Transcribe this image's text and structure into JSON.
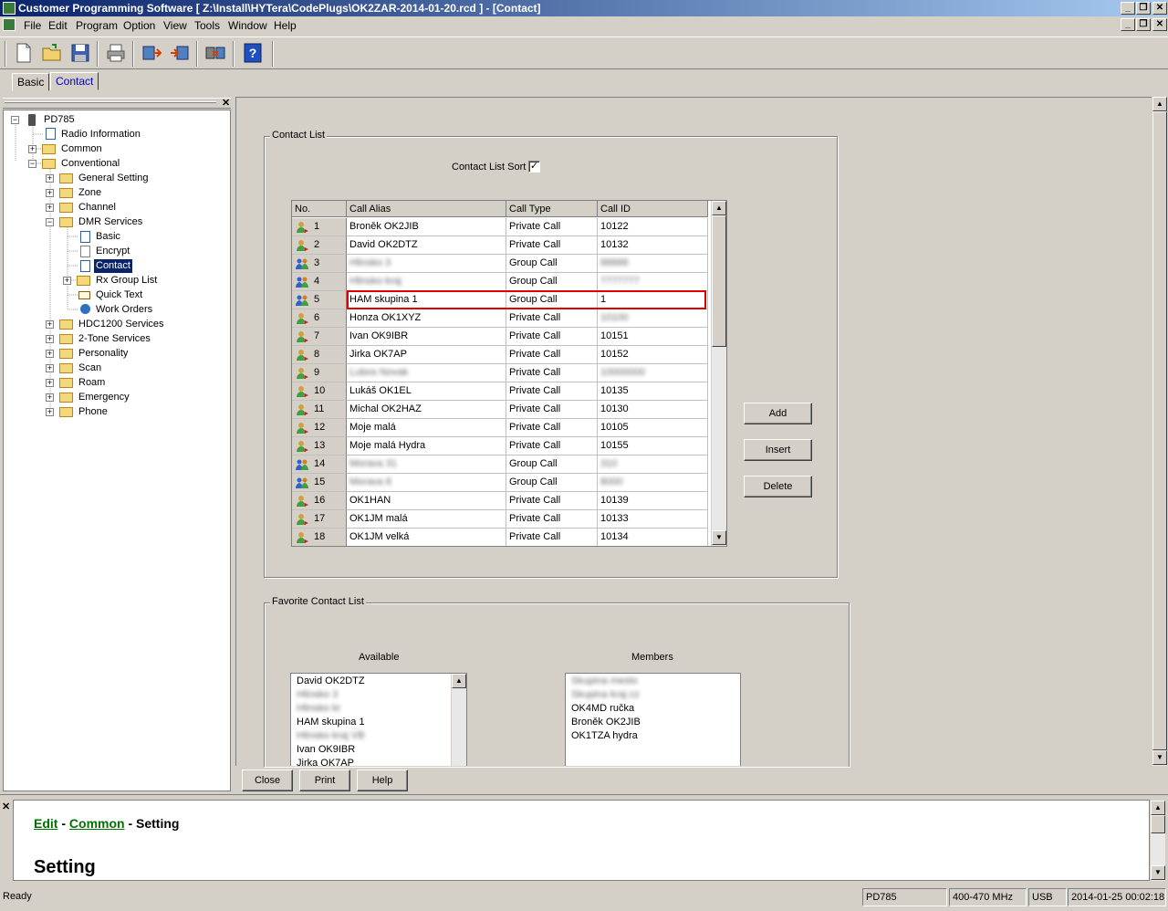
{
  "window": {
    "title": "Customer Programming Software [ Z:\\Install\\HYTera\\CodePlugs\\OK2ZAR-2014-01-20.rcd ] - [Contact]"
  },
  "menu": [
    "File",
    "Edit",
    "Program",
    "Option",
    "View",
    "Tools",
    "Window",
    "Help"
  ],
  "tabs": {
    "basic": "Basic",
    "contact": "Contact"
  },
  "tree": {
    "root": "PD785",
    "radio_information": "Radio Information",
    "common": "Common",
    "conventional": "Conventional",
    "general_setting": "General Setting",
    "zone": "Zone",
    "channel": "Channel",
    "dmr_services": "DMR Services",
    "basic": "Basic",
    "encrypt": "Encrypt",
    "contact": "Contact",
    "rx_group_list": "Rx Group List",
    "quick_text": "Quick Text",
    "work_orders": "Work Orders",
    "hdc1200": "HDC1200 Services",
    "two_tone": "2-Tone Services",
    "personality": "Personality",
    "scan": "Scan",
    "roam": "Roam",
    "emergency": "Emergency",
    "phone": "Phone"
  },
  "contact_list": {
    "group_title": "Contact List",
    "sort_label": "Contact List Sort",
    "sort_checked": true,
    "columns": [
      "No.",
      "Call Alias",
      "Call Type",
      "Call ID"
    ],
    "rows": [
      {
        "no": "1",
        "alias": "Broněk OK2JIB",
        "type": "Private Call",
        "id": "10122",
        "group": false
      },
      {
        "no": "2",
        "alias": "David OK2DTZ",
        "type": "Private Call",
        "id": "10132",
        "group": false
      },
      {
        "no": "3",
        "alias": "Hlinsko 3",
        "type": "Group Call",
        "id": "88888",
        "group": true,
        "blur_alias": true,
        "blur_id": true
      },
      {
        "no": "4",
        "alias": "Hlinsko kraj",
        "type": "Group Call",
        "id": "7777777",
        "group": true,
        "blur_alias": true,
        "blur_id": true
      },
      {
        "no": "5",
        "alias": "HAM skupina 1",
        "type": "Group Call",
        "id": "1",
        "group": true,
        "selected": true
      },
      {
        "no": "6",
        "alias": "Honza OK1XYZ",
        "type": "Private Call",
        "id": "10100",
        "group": false,
        "blur_alias_tail": true,
        "blur_id": true
      },
      {
        "no": "7",
        "alias": "Ivan OK9IBR",
        "type": "Private Call",
        "id": "10151",
        "group": false
      },
      {
        "no": "8",
        "alias": "Jirka OK7AP",
        "type": "Private Call",
        "id": "10152",
        "group": false
      },
      {
        "no": "9",
        "alias": "Lubos Novak",
        "type": "Private Call",
        "id": "10000000",
        "group": false,
        "blur_alias": true,
        "blur_id": true
      },
      {
        "no": "10",
        "alias": "Lukáš OK1EL",
        "type": "Private Call",
        "id": "10135",
        "group": false
      },
      {
        "no": "11",
        "alias": "Michal OK2HAZ",
        "type": "Private Call",
        "id": "10130",
        "group": false
      },
      {
        "no": "12",
        "alias": "Moje malá",
        "type": "Private Call",
        "id": "10105",
        "group": false
      },
      {
        "no": "13",
        "alias": "Moje malá Hydra",
        "type": "Private Call",
        "id": "10155",
        "group": false
      },
      {
        "no": "14",
        "alias": "Morava 31",
        "type": "Group Call",
        "id": "310",
        "group": true,
        "blur_alias": true,
        "blur_id": true
      },
      {
        "no": "15",
        "alias": "Morava 8",
        "type": "Group Call",
        "id": "8000",
        "group": true,
        "blur_alias": true,
        "blur_id": true
      },
      {
        "no": "16",
        "alias": "OK1HAN",
        "type": "Private Call",
        "id": "10139",
        "group": false
      },
      {
        "no": "17",
        "alias": "OK1JM malá",
        "type": "Private Call",
        "id": "10133",
        "group": false
      },
      {
        "no": "18",
        "alias": "OK1JM velká",
        "type": "Private Call",
        "id": "10134",
        "group": false
      }
    ]
  },
  "buttons": {
    "add": "Add",
    "insert": "Insert",
    "delete": "Delete",
    "close": "Close",
    "print": "Print",
    "help": "Help"
  },
  "favorite": {
    "group_title": "Favorite Contact List",
    "available_label": "Available",
    "members_label": "Members",
    "available": [
      {
        "text": "David OK2DTZ"
      },
      {
        "text": "Hlinsko 3",
        "blur": true
      },
      {
        "text": "Hlinsko kr",
        "blur": true
      },
      {
        "text": "HAM skupina 1"
      },
      {
        "text": "Hlinsko kraj VB",
        "blur": true
      },
      {
        "text": "Ivan OK9IBR"
      },
      {
        "text": "Jirka OK7AP"
      }
    ],
    "members": [
      {
        "text": "Skupina mesto",
        "blur": true
      },
      {
        "text": "Skupina kraj cz",
        "blur": true
      },
      {
        "text": "OK4MD ručka"
      },
      {
        "text": "Broněk OK2JIB"
      },
      {
        "text": "OK1TZA hydra"
      }
    ]
  },
  "help": {
    "crumb_edit": "Edit",
    "crumb_sep1": " - ",
    "crumb_common": "Common",
    "crumb_sep2": " - Setting",
    "heading": "Setting"
  },
  "status": {
    "text": "Ready",
    "model": "PD785",
    "band": "400-470 MHz",
    "port": "USB",
    "datetime": "2014-01-25 00:02:18"
  },
  "colors": {
    "title_start": "#0a246a",
    "title_end": "#a6caf0",
    "tab_active_text": "#0000cc",
    "selection": "#0a246a",
    "selected_row_border": "#e00000",
    "help_link": "#007000"
  }
}
